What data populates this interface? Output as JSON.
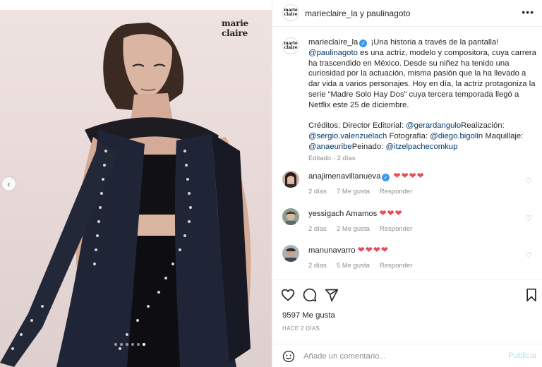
{
  "photo": {
    "brand": "marie claire"
  },
  "header": {
    "avatar_label": [
      "marie",
      "claire"
    ],
    "title": "marieclaire_la y paulinagoto",
    "more": "•••"
  },
  "caption": {
    "username": "marieclaire_la",
    "text_1": "¡Una historia a través de la pantalla!",
    "mention_1": "@paulinagoto",
    "text_2": "es una actriz, modelo y compositora, cuya carrera ha trascendido en México. Desde su niñez ha tenido una curiosidad por la actuación, misma pasión que la ha llevado a dar vida a varios personajes. Hoy en día, la actriz protagoniza la serie “Madre Solo Hay Dos” cuya tercera temporada llegó a Netflix este 25 de diciembre.",
    "credits_label": "Créditos: Director Editorial:",
    "mention_2": "@gerardangulo",
    "realizacion": "Realización:",
    "mention_3": "@sergio.valenzuelach",
    "fotografia": "Fotografía:",
    "mention_4": "@diego.bigolin",
    "maquillaje": "Maquillaje:",
    "mention_5": "@anaeuribe",
    "peinado": "Peinado:",
    "mention_6": "@itzelpachecomkup",
    "meta": "Editado · 2 días"
  },
  "comments": [
    {
      "username": "anajimenavillanueva",
      "verified": true,
      "text": "",
      "hearts": "❤❤❤❤",
      "time": "2 días",
      "likes": "7 Me gusta",
      "reply": "Responder"
    },
    {
      "username": "yessigach",
      "verified": false,
      "text": "Amamos",
      "hearts": "❤❤❤",
      "time": "2 días",
      "likes": "2 Me gusta",
      "reply": "Responder"
    },
    {
      "username": "manunavarro",
      "verified": false,
      "text": "",
      "hearts": "❤❤❤❤",
      "time": "2 días",
      "likes": "5 Me gusta",
      "reply": "Responder"
    }
  ],
  "stats": {
    "likes": "9597 Me gusta",
    "ago": "HACE 2 DÍAS"
  },
  "add_comment": {
    "placeholder": "Añade un comentario...",
    "post_label": "Publicar"
  },
  "colors": {
    "link": "#00376b",
    "heart": "#ed4956",
    "verified": "#3897f0",
    "post_disabled": "#b2dffc"
  },
  "icons": [
    "more-icon",
    "verified-icon",
    "heart-icon",
    "comment-icon",
    "share-icon",
    "bookmark-icon",
    "emoji-icon",
    "chevron-left-icon"
  ]
}
